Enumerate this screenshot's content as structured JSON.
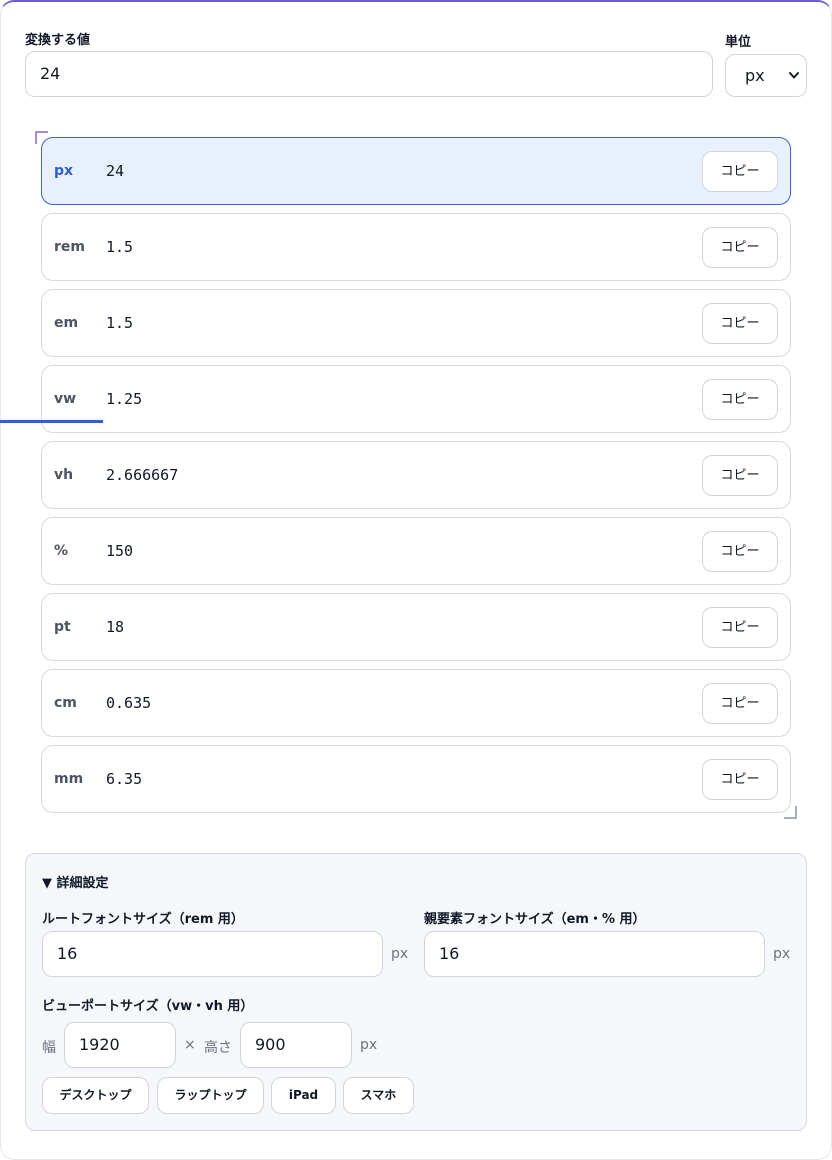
{
  "converter": {
    "value_label": "変換する値",
    "value": "24",
    "unit_label": "単位",
    "unit_selected": "px",
    "rows": [
      {
        "unit": "px",
        "value": "24",
        "copy_label": "コピー",
        "active": true
      },
      {
        "unit": "rem",
        "value": "1.5",
        "copy_label": "コピー"
      },
      {
        "unit": "em",
        "value": "1.5",
        "copy_label": "コピー"
      },
      {
        "unit": "vw",
        "value": "1.25",
        "copy_label": "コピー"
      },
      {
        "unit": "vh",
        "value": "2.666667",
        "copy_label": "コピー"
      },
      {
        "unit": "%",
        "value": "150",
        "copy_label": "コピー"
      },
      {
        "unit": "pt",
        "value": "18",
        "copy_label": "コピー"
      },
      {
        "unit": "cm",
        "value": "0.635",
        "copy_label": "コピー"
      },
      {
        "unit": "mm",
        "value": "6.35",
        "copy_label": "コピー"
      }
    ]
  },
  "advanced": {
    "summary": "▼ 詳細設定",
    "root_font_label": "ルートフォントサイズ（rem 用）",
    "root_font_value": "16",
    "root_font_unit": "px",
    "parent_font_label": "親要素フォントサイズ（em・% 用）",
    "parent_font_value": "16",
    "parent_font_unit": "px",
    "viewport_label": "ビューポートサイズ（vw・vh 用）",
    "width_label": "幅",
    "width_value": "1920",
    "times": "×",
    "height_label": "高さ",
    "height_value": "900",
    "viewport_unit": "px",
    "presets": [
      "デスクトップ",
      "ラップトップ",
      "iPad",
      "スマホ"
    ]
  }
}
